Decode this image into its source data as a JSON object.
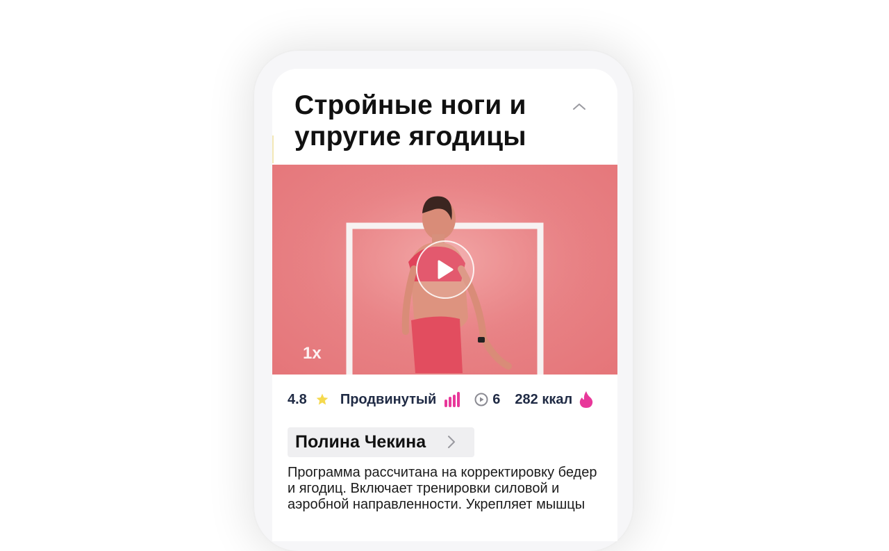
{
  "program": {
    "title": "Стройные ноги и упругие ягодицы",
    "video": {
      "speed": "1x"
    },
    "stats": {
      "rating": "4.8",
      "level": "Продвинутый",
      "videos": "6",
      "calories": "282 ккал"
    },
    "trainer": {
      "name": "Полина Чекина"
    },
    "description": "Программа рассчитана на корректировку бедер и ягодиц. Включает тренировки силовой и аэробной направленности. Укрепляет мышцы"
  },
  "icons": {
    "collapse": "chevron-up-icon",
    "play": "play-icon",
    "rating": "star-icon",
    "level": "level-bars-icon",
    "videos": "play-circle-icon",
    "calories": "flame-icon",
    "trainer": "chevron-right-icon"
  },
  "colors": {
    "accent": "#e8389a",
    "star": "#f5d94e",
    "video_bg": "#e88386",
    "text_dark": "#1f2a44"
  }
}
